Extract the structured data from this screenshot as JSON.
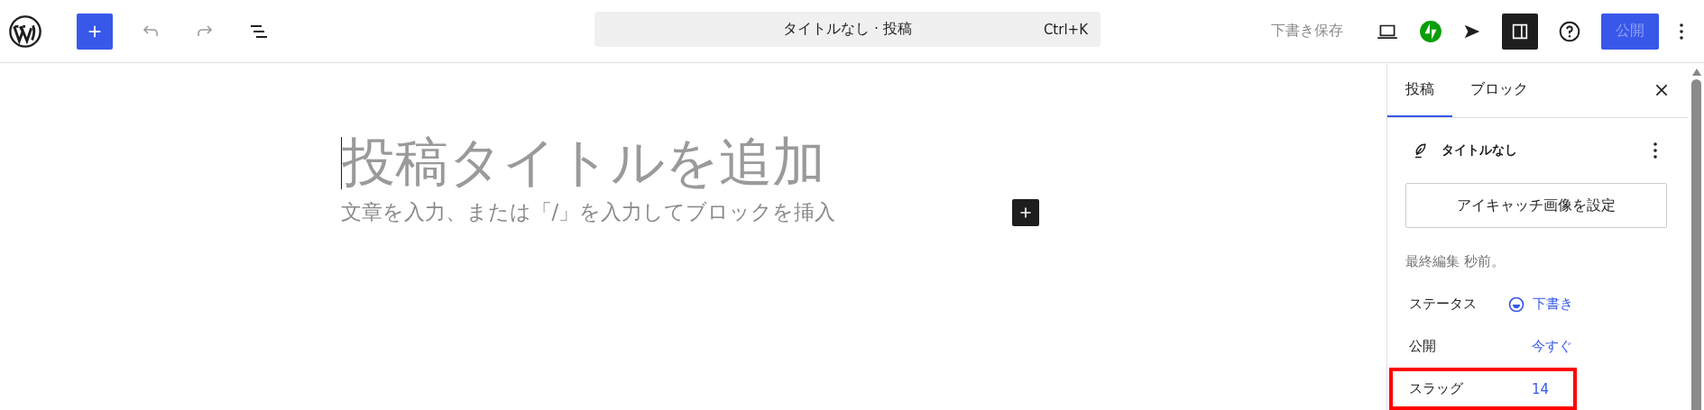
{
  "toolbar": {
    "undo_disabled": true,
    "redo_disabled": true
  },
  "command_bar": {
    "title": "タイトルなし · 投稿",
    "shortcut": "Ctrl+K"
  },
  "actions": {
    "save_draft": "下書き保存",
    "sidebar_open": true,
    "publish": "公開",
    "publish_disabled": true
  },
  "editor": {
    "title_placeholder": "投稿タイトルを追加",
    "body_placeholder": "文章を入力、または「/」を入力してブロックを挿入"
  },
  "sidebar": {
    "tabs": [
      {
        "label": "投稿",
        "selected": true
      },
      {
        "label": "ブロック",
        "selected": false
      }
    ],
    "post_title": "タイトルなし",
    "featured_image_button": "アイキャッチ画像を設定",
    "last_edited": "最終編集 秒前。",
    "rows": [
      {
        "kind": "status",
        "label": "ステータス",
        "value": "下書き",
        "highlighted": false
      },
      {
        "kind": "link",
        "label": "公開",
        "value": "今すぐ",
        "highlighted": false
      },
      {
        "kind": "link",
        "label": "スラッグ",
        "value": "14",
        "highlighted": true
      }
    ]
  }
}
